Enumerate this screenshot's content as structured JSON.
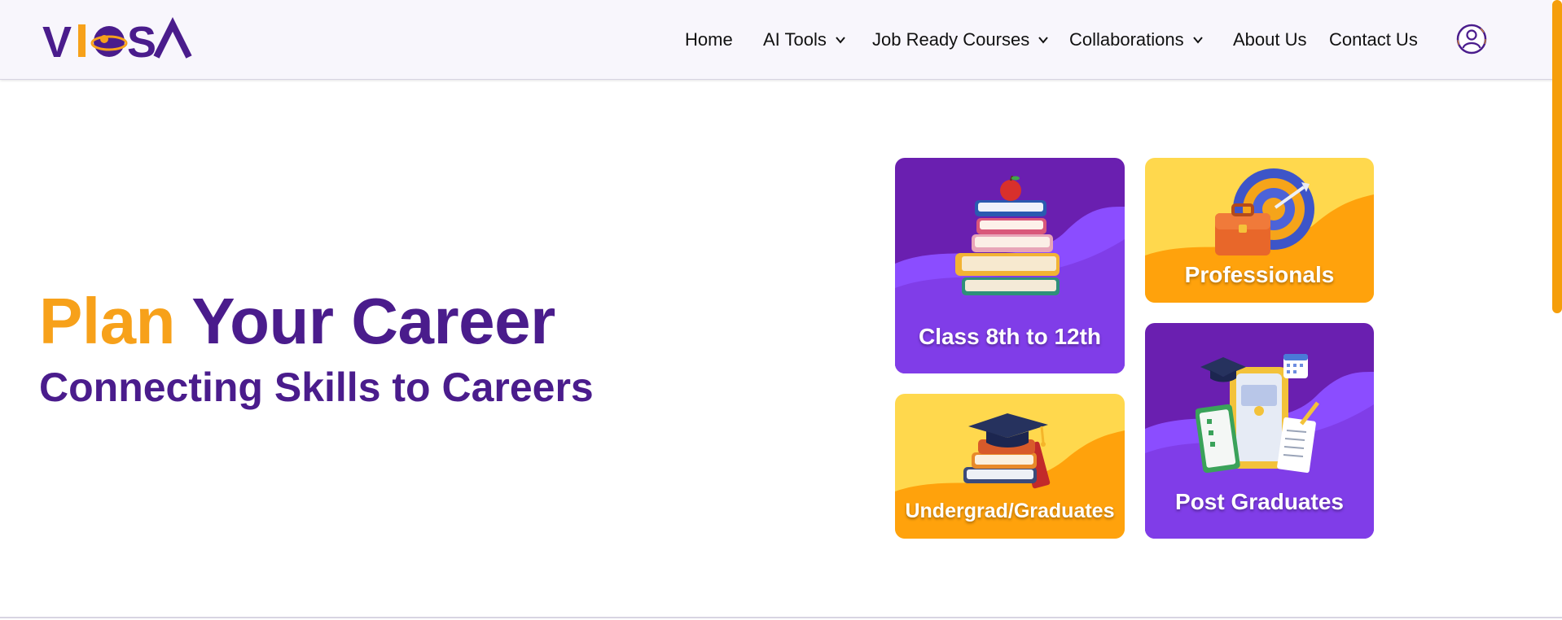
{
  "brand": {
    "logo_text": "VIOSA",
    "purple": "#4a1c8c",
    "orange": "#f7a11a"
  },
  "nav": {
    "items": [
      {
        "label": "Home",
        "has_dropdown": false
      },
      {
        "label": "AI Tools",
        "has_dropdown": true
      },
      {
        "label": "Job Ready Courses",
        "has_dropdown": true
      },
      {
        "label": "Collaborations",
        "has_dropdown": true
      },
      {
        "label": "About Us",
        "has_dropdown": false
      },
      {
        "label": "Contact Us",
        "has_dropdown": false
      }
    ],
    "user_icon": "user-circle-icon"
  },
  "hero": {
    "title_highlight": "Plan",
    "title_rest": "Your Career",
    "subtitle": "Connecting Skills to Careers"
  },
  "cards": [
    {
      "label": "Class 8th to 12th",
      "theme": "purple",
      "icon": "books-apple-icon"
    },
    {
      "label": "Professionals",
      "theme": "yellow",
      "icon": "briefcase-target-icon"
    },
    {
      "label": "Undergrad/Graduates",
      "theme": "yellow",
      "icon": "grad-cap-books-icon"
    },
    {
      "label": "Post Graduates",
      "theme": "purple",
      "icon": "grad-cap-documents-icon"
    }
  ],
  "colors": {
    "card_purple": "#6a1fb0",
    "card_purple_wave": "#8b4dff",
    "card_yellow": "#ffd84d",
    "card_yellow_wave": "#ffa20c",
    "scrollbar": "#f59e0b"
  }
}
